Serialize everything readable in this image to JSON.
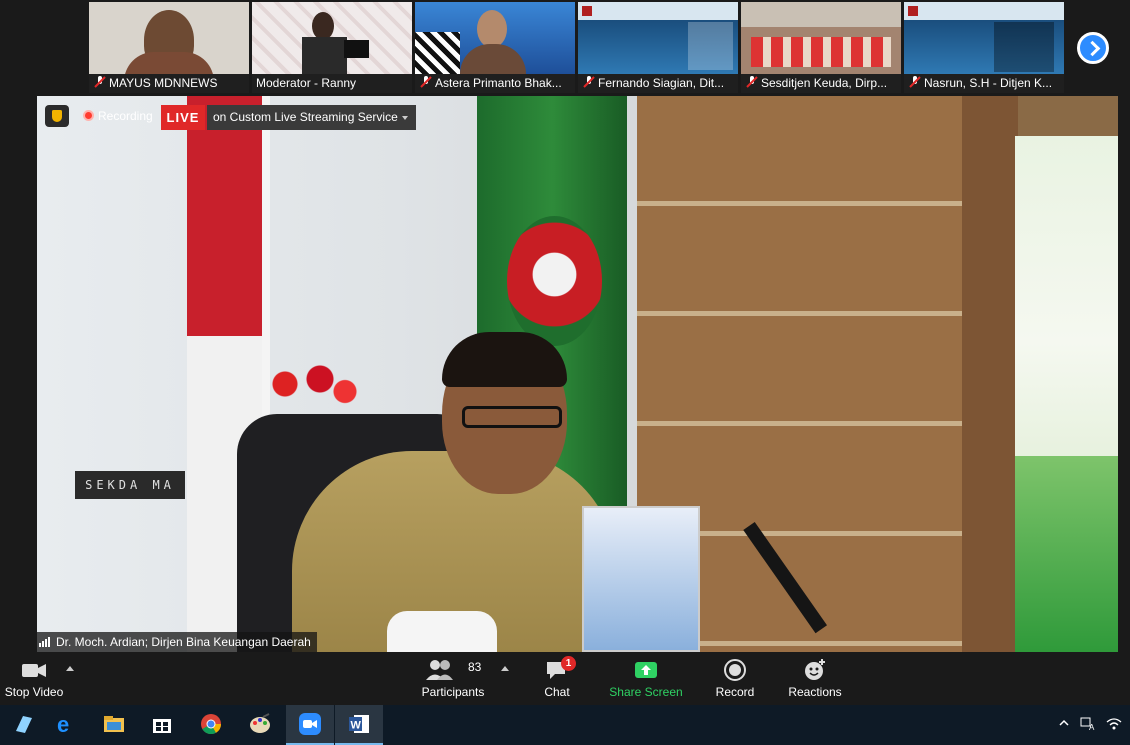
{
  "thumbnails": [
    {
      "name": "MAYUS MDNNEWS",
      "bg": "#d9d4cc"
    },
    {
      "name": "Moderator - Ranny",
      "bg": "#e8e0e0"
    },
    {
      "name": "Astera Primanto Bhak...",
      "bg": "#2a68b8"
    },
    {
      "name": "Fernando Siagian, Dit...",
      "bg": "#1f5b8f"
    },
    {
      "name": "Sesditjen Keuda, Dirp...",
      "bg": "#a88e7a"
    },
    {
      "name": "Nasrun, S.H - Ditjen K...",
      "bg": "#1f5b8f"
    }
  ],
  "stage": {
    "recording_label": "Recording",
    "live_label": "LIVE",
    "stream_service": "on Custom Live Streaming Service",
    "speaker_name": "Dr. Moch. Ardian; Dirjen Bina Keuangan Daerah",
    "nameplate": "SEKDA MA"
  },
  "toolbar": {
    "stop_video": "Stop Video",
    "participants": "Participants",
    "participants_count": "83",
    "chat": "Chat",
    "chat_badge": "1",
    "share_screen": "Share Screen",
    "record": "Record",
    "reactions": "Reactions"
  },
  "colors": {
    "accent": "#2d8cff",
    "share_green": "#2fd163",
    "live_red": "#e02828"
  }
}
